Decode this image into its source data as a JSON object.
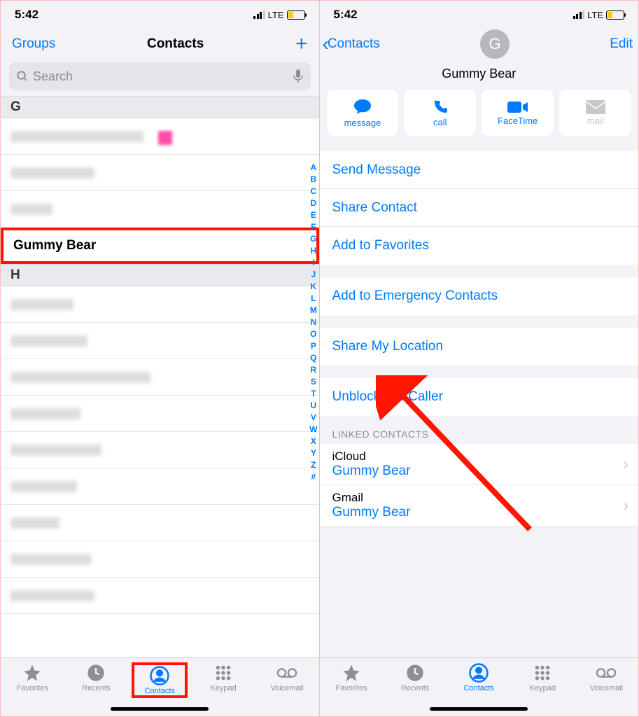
{
  "status": {
    "time": "5:42",
    "carrier": "LTE"
  },
  "left": {
    "nav": {
      "groups": "Groups",
      "title": "Contacts"
    },
    "search_placeholder": "Search",
    "sections": {
      "g": "G",
      "h": "H"
    },
    "highlighted_contact": "Gummy Bear",
    "index": [
      "A",
      "B",
      "C",
      "D",
      "E",
      "F",
      "G",
      "H",
      "I",
      "J",
      "K",
      "L",
      "M",
      "N",
      "O",
      "P",
      "Q",
      "R",
      "S",
      "T",
      "U",
      "V",
      "W",
      "X",
      "Y",
      "Z",
      "#"
    ]
  },
  "right": {
    "back_label": "Contacts",
    "edit": "Edit",
    "avatar_letter": "G",
    "name": "Gummy Bear",
    "actions": {
      "message": "message",
      "call": "call",
      "facetime": "FaceTime",
      "mail": "mail"
    },
    "cells": {
      "send_message": "Send Message",
      "share_contact": "Share Contact",
      "add_favorites": "Add to Favorites",
      "emergency": "Add to Emergency Contacts",
      "share_location": "Share My Location",
      "unblock": "Unblock this Caller"
    },
    "linked_header": "LINKED CONTACTS",
    "linked": [
      {
        "source": "iCloud",
        "name": "Gummy Bear"
      },
      {
        "source": "Gmail",
        "name": "Gummy Bear"
      }
    ]
  },
  "tabs": {
    "favorites": "Favorites",
    "recents": "Recents",
    "contacts": "Contacts",
    "keypad": "Keypad",
    "voicemail": "Voicemail"
  }
}
